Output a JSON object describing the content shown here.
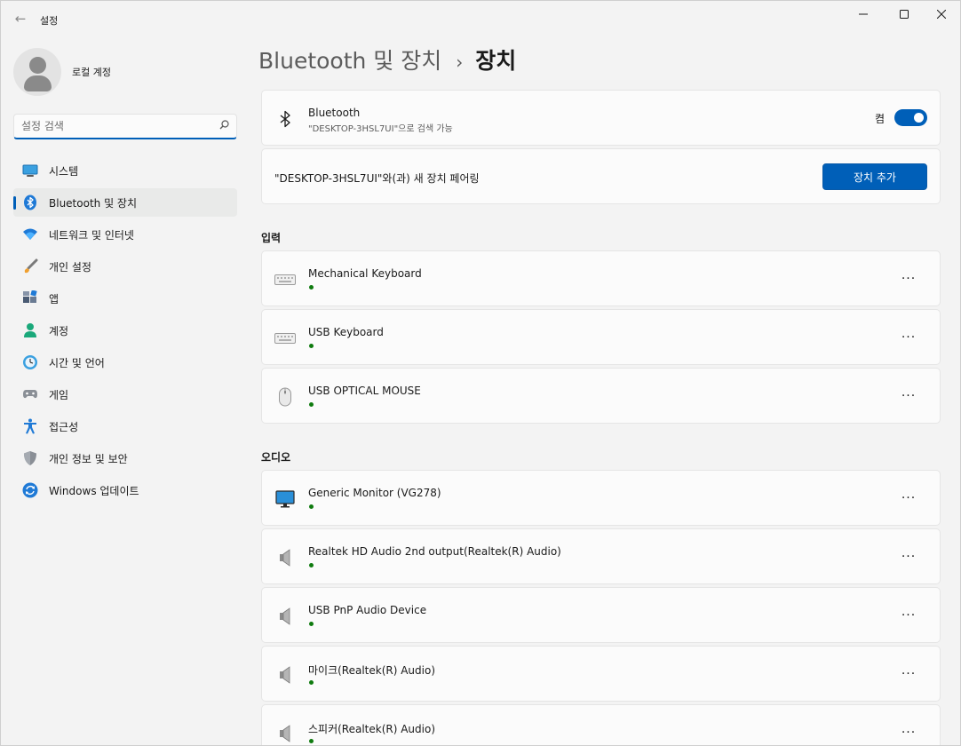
{
  "titlebar": {
    "app_title": "설정",
    "back_icon": "back-arrow-icon"
  },
  "profile": {
    "name": "로컬 계정"
  },
  "search": {
    "placeholder": "설정 검색"
  },
  "nav": {
    "items": [
      {
        "label": "시스템",
        "icon": "system-icon"
      },
      {
        "label": "Bluetooth 및 장치",
        "icon": "bluetooth-icon",
        "active": true
      },
      {
        "label": "네트워크 및 인터넷",
        "icon": "network-icon"
      },
      {
        "label": "개인 설정",
        "icon": "personalization-icon"
      },
      {
        "label": "앱",
        "icon": "apps-icon"
      },
      {
        "label": "계정",
        "icon": "account-icon"
      },
      {
        "label": "시간 및 언어",
        "icon": "time-language-icon"
      },
      {
        "label": "게임",
        "icon": "gaming-icon"
      },
      {
        "label": "접근성",
        "icon": "accessibility-icon"
      },
      {
        "label": "개인 정보 및 보안",
        "icon": "privacy-shield-icon"
      },
      {
        "label": "Windows 업데이트",
        "icon": "windows-update-icon"
      }
    ]
  },
  "breadcrumb": {
    "parent": "Bluetooth 및 장치",
    "separator": "›",
    "current": "장치"
  },
  "bluetooth_card": {
    "title": "Bluetooth",
    "subtitle": "\"DESKTOP-3HSL7UI\"으로 검색 가능",
    "toggle_label": "켬",
    "toggle_on": true
  },
  "pair_card": {
    "text": "\"DESKTOP-3HSL7UI\"와(과) 새 장치 페어링",
    "button_label": "장치 추가"
  },
  "sections": {
    "input": {
      "title": "입력",
      "devices": [
        {
          "name": "Mechanical Keyboard",
          "icon": "keyboard-icon"
        },
        {
          "name": "USB Keyboard",
          "icon": "keyboard-icon"
        },
        {
          "name": "USB OPTICAL MOUSE",
          "icon": "mouse-icon"
        }
      ]
    },
    "audio": {
      "title": "오디오",
      "devices": [
        {
          "name": "Generic Monitor (VG278)",
          "icon": "monitor-icon"
        },
        {
          "name": "Realtek HD Audio 2nd output(Realtek(R) Audio)",
          "icon": "speaker-icon"
        },
        {
          "name": "USB PnP Audio Device",
          "icon": "speaker-icon"
        },
        {
          "name": "마이크(Realtek(R) Audio)",
          "icon": "speaker-icon"
        },
        {
          "name": "스피커(Realtek(R) Audio)",
          "icon": "speaker-icon"
        }
      ]
    }
  },
  "more_label": "···",
  "colors": {
    "accent": "#005fb8",
    "connected": "#0f7b0f"
  }
}
